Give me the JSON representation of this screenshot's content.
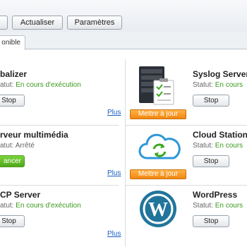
{
  "toolbar": {
    "buttons": [
      {
        "label": ""
      },
      {
        "label": "Actualiser"
      },
      {
        "label": "Paramètres"
      }
    ]
  },
  "tabs": [
    {
      "label": "onible"
    }
  ],
  "packages": [
    {
      "title": "balizer",
      "status_prefix": "atut:",
      "status_value": "En cours d'exécution",
      "status_state": "running",
      "action_label": "Stop",
      "more_label": "Plus"
    },
    {
      "title": "Syslog Server",
      "status_prefix": "Statut:",
      "status_value": "En cours",
      "status_state": "running",
      "action_label": "Stop",
      "update_label": "Mettre à jour",
      "icon": "syslog-server-icon"
    },
    {
      "title": "rveur multimédia",
      "status_prefix": "atut:",
      "status_value": "Arrêté",
      "status_state": "stopped",
      "action_label": "ancer",
      "more_label": "Plus"
    },
    {
      "title": "Cloud Station",
      "status_prefix": "Statut:",
      "status_value": "En cours",
      "status_state": "running",
      "action_label": "Stop",
      "update_label": "Mettre à jour",
      "icon": "cloud-sync-icon"
    },
    {
      "title": "CP Server",
      "status_prefix": "atut:",
      "status_value": "En cours d'exécution",
      "status_state": "running",
      "action_label": "Stop",
      "more_label": "Plus"
    },
    {
      "title": "WordPress",
      "status_prefix": "Statut:",
      "status_value": "En cours",
      "status_state": "running",
      "action_label": "Stop",
      "icon": "wordpress-icon"
    }
  ],
  "colors": {
    "running": "#3a9a1c",
    "link": "#1a5fc4",
    "update": "#f2860f",
    "run_button": "#5cb82a"
  }
}
